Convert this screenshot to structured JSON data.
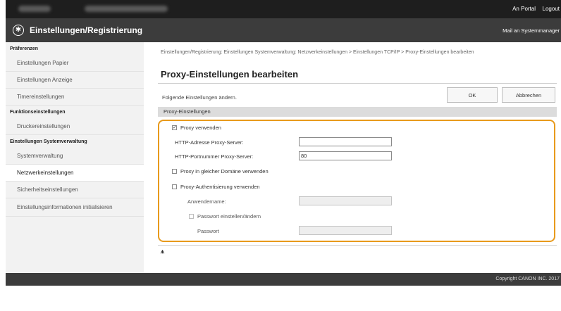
{
  "topbar": {
    "portal_label": "An Portal",
    "logout_label": "Logout"
  },
  "header": {
    "title": "Einstellungen/Registrierung",
    "mail_label": "Mail an Systemmanager",
    "icon": "settings-gear-icon"
  },
  "sidebar": {
    "sections": [
      {
        "heading": "Präferenzen",
        "items": [
          {
            "label": "Einstellungen Papier"
          },
          {
            "label": "Einstellungen Anzeige"
          },
          {
            "label": "Timereinstellungen"
          }
        ]
      },
      {
        "heading": "Funktionseinstellungen",
        "items": [
          {
            "label": "Druckereinstellungen"
          }
        ]
      },
      {
        "heading": "Einstellungen Systemverwaltung",
        "items": [
          {
            "label": "Systemverwaltung"
          },
          {
            "label": "Netzwerkeinstellungen",
            "active": true
          },
          {
            "label": "Sicherheitseinstellungen"
          },
          {
            "label": "Einstellungsinformationen initialisieren"
          }
        ]
      }
    ]
  },
  "main": {
    "breadcrumb": "Einstellungen/Registrierung: Einstellungen Systemverwaltung: Netzwerkeinstellungen > Einstellungen TCP/IP > Proxy-Einstellungen bearbeiten",
    "title": "Proxy-Einstellungen bearbeiten",
    "note": "Folgende Einstellungen ändern.",
    "ok_label": "OK",
    "cancel_label": "Abbrechen",
    "section_title": "Proxy-Einstellungen",
    "use_proxy_label": "Proxy verwenden",
    "use_proxy_checked": true,
    "http_address_label": "HTTP-Adresse Proxy-Server:",
    "http_address_value": "",
    "http_port_label": "HTTP-Portnummer Proxy-Server:",
    "http_port_value": "80",
    "same_domain_label": "Proxy in gleicher Domäne verwenden",
    "same_domain_checked": false,
    "auth_label": "Proxy-Authentisierung verwenden",
    "auth_checked": false,
    "username_label": "Anwendername:",
    "username_value": "",
    "set_password_label": "Passwort einstellen/ändern",
    "set_password_checked": false,
    "password_label": "Passwort",
    "password_value": "",
    "back_to_top_icon": "back-to-top-icon",
    "highlight_color": "#e89a1c"
  },
  "footer": {
    "copyright": "Copyright CANON INC. 2017"
  }
}
